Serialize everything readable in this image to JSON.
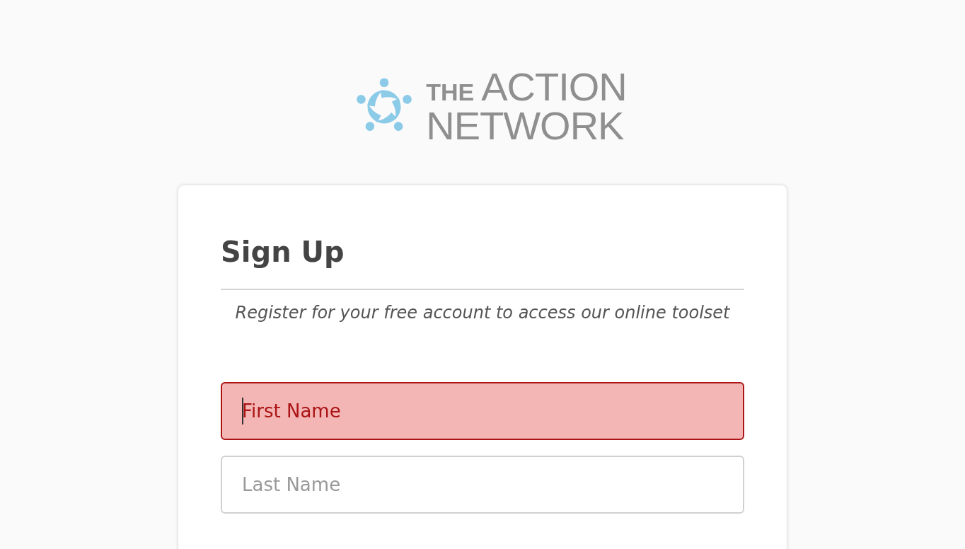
{
  "logo": {
    "small": "THE",
    "line1": "ACTION",
    "line2": "NETWORK"
  },
  "form": {
    "title": "Sign Up",
    "subtitle": "Register for your free account to access our online toolset",
    "fields": [
      {
        "placeholder": "First Name",
        "error": true,
        "focused": true
      },
      {
        "placeholder": "Last Name",
        "error": false,
        "focused": false
      }
    ]
  }
}
